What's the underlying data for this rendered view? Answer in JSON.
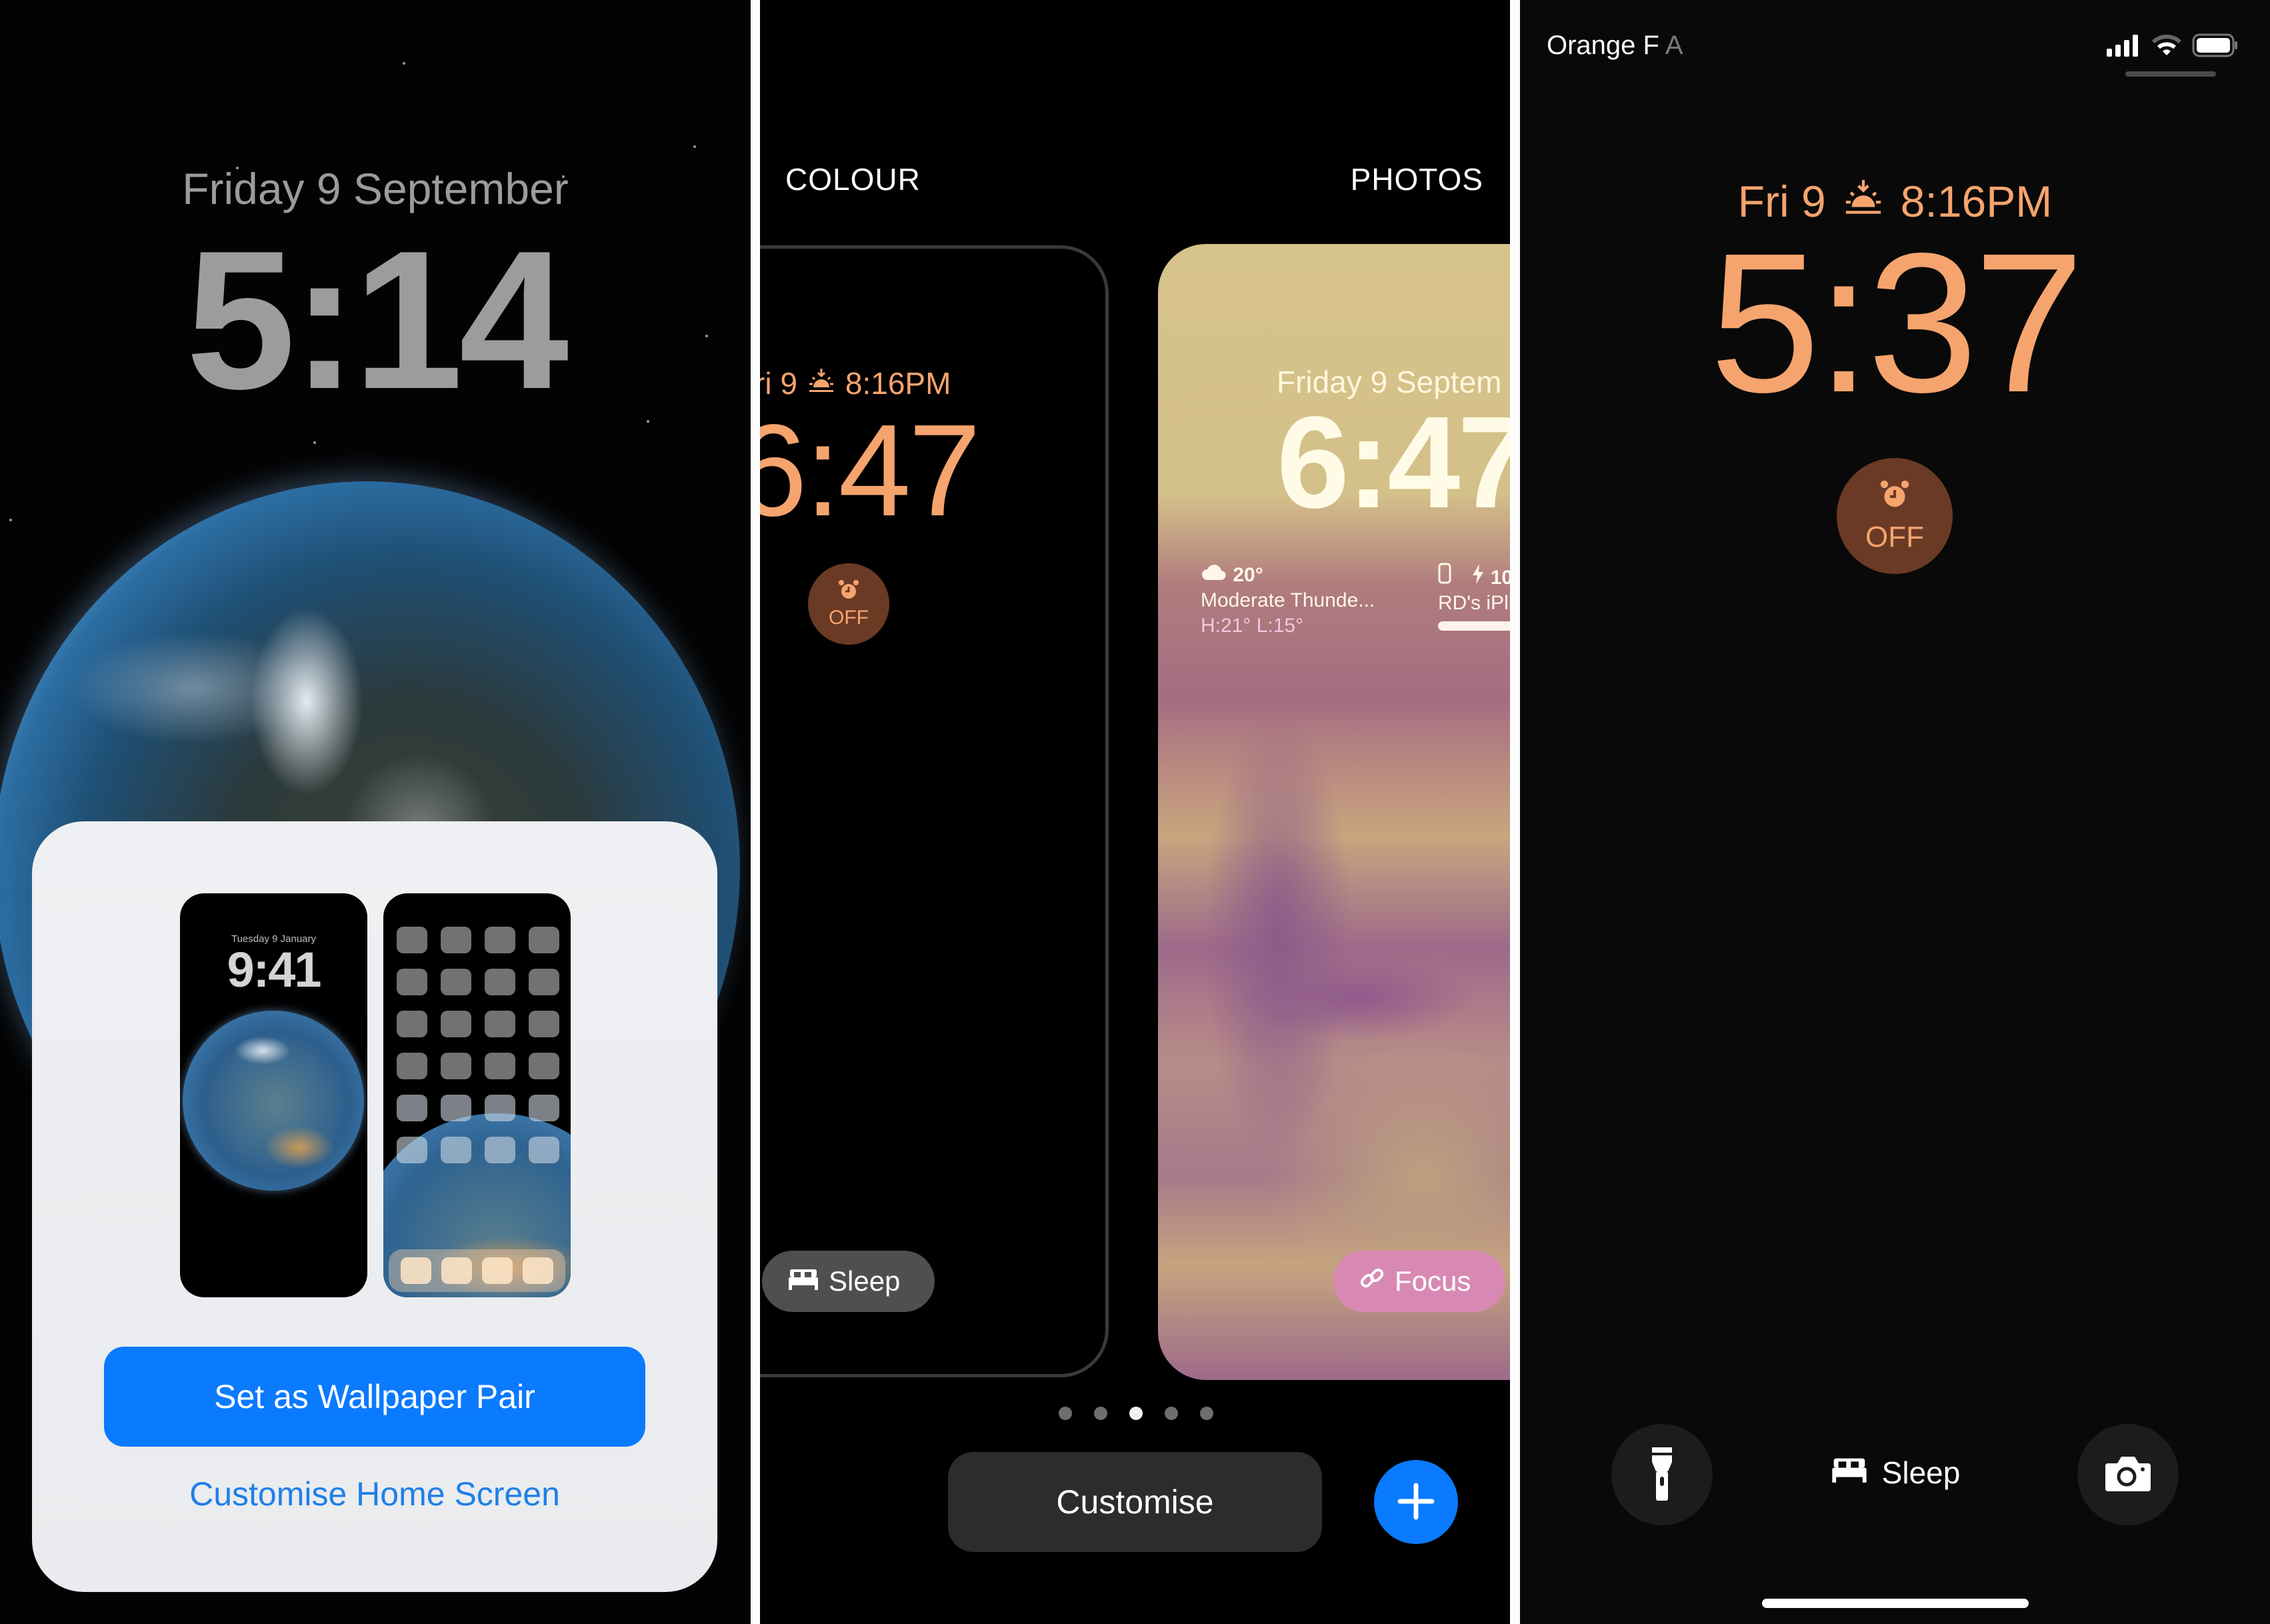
{
  "panel1": {
    "date": "Friday 9 September",
    "time": "5:14",
    "sheet": {
      "preview_lock": {
        "date": "Tuesday 9 January",
        "time": "9:41"
      },
      "primary_button": "Set as Wallpaper Pair",
      "secondary_link": "Customise Home Screen"
    }
  },
  "panel2": {
    "categories": {
      "left": "COLOUR",
      "right": "PHOTOS"
    },
    "colour_card": {
      "date_short": "ri 9",
      "sunset_time": "8:16PM",
      "time": "6:47",
      "alarm_label": "OFF",
      "focus_pill": "Sleep"
    },
    "photos_card": {
      "date": "Friday 9 Septem",
      "time": "6:47",
      "weather": {
        "temp": "20°",
        "condition": "Moderate Thunde...",
        "high_low": "H:21° L:15°"
      },
      "battery": {
        "value": "10",
        "device": "RD's iPl"
      },
      "focus_pill": "Focus"
    },
    "page_dots": {
      "count": 5,
      "active_index": 2
    },
    "customise_button": "Customise",
    "add_button_icon": "plus-icon"
  },
  "panel3": {
    "status_bar": {
      "carrier": "Orange F",
      "carrier_faded": "A"
    },
    "date_short": "Fri 9",
    "sunset_time": "8:16PM",
    "time": "5:37",
    "alarm_label": "OFF",
    "focus_label": "Sleep"
  },
  "colors": {
    "accent_blue": "#0a7aff",
    "link_blue": "#1f7fe8",
    "sleep_orange": "#f5a46e",
    "alarm_bg": "#6b3a24",
    "focus_pink": "#d889b3"
  }
}
